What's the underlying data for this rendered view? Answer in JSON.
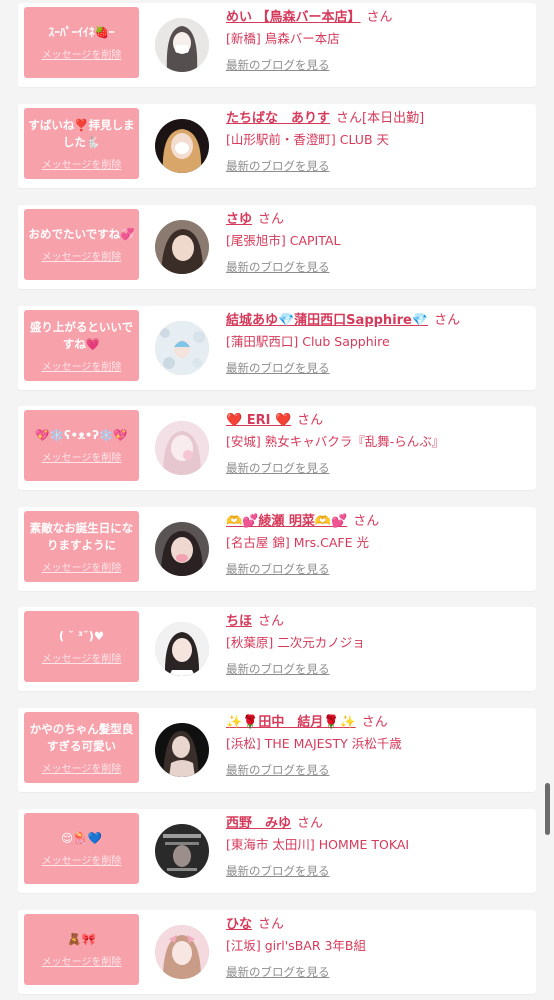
{
  "common": {
    "delete_label": "メッセージを削除",
    "blog_label": "最新のブログを見る"
  },
  "colors": {
    "stamp_bg": "#f7a1ab",
    "name": "#d63a5b",
    "link_gray": "#8d8d8d",
    "page_bg": "#f4f4f4"
  },
  "items": [
    {
      "stamp": "ｽｰﾊﾟｰｲｲﾈ🍓ｰ",
      "name": "めい 【鳥森バー本店】",
      "san": "さん",
      "shop": "[新橋] 鳥森バー本店"
    },
    {
      "stamp": "すばいね❣️拝見しました🐇",
      "name": "たちばな　ありす",
      "san": "さん[本日出勤]",
      "shop": "[山形駅前・香澄町] CLUB 天"
    },
    {
      "stamp": "おめでたいですね💞",
      "name": "さゆ",
      "san": "さん",
      "shop": "[尾張旭市] CAPITAL"
    },
    {
      "stamp": "盛り上がるといいですね💗",
      "name": "結城あゆ💎蒲田西口Sapphire💎",
      "san": "さん",
      "shop": "[蒲田駅西口] Club Sapphire"
    },
    {
      "stamp": "💖❄️ʕ•ᴥ•ʔ❄️💖",
      "name": "❤️ ERI ❤️",
      "san": "さん",
      "shop": "[安城] 熟女キャバクラ『乱舞-らんぶ』"
    },
    {
      "stamp": "素敵なお誕生日になりますように",
      "name": "🫶💕綾瀬 明菜🫶💕",
      "san": "さん",
      "shop": "[名古屋 錦] Mrs.CAFE 光"
    },
    {
      "stamp": "( ˘ ³˘)♥",
      "name": "ちほ",
      "san": "さん",
      "shop": "[秋葉原] 二次元カノジョ"
    },
    {
      "stamp": "かやのちゃん髪型良すぎる可愛い",
      "name": "✨🌹田中　結月🌹✨",
      "san": "さん",
      "shop": "[浜松] THE MAJESTY 浜松千歳"
    },
    {
      "stamp": "😌🪼💙",
      "name": "西野　みゆ",
      "san": "さん",
      "shop": "[東海市 太田川] HOMME TOKAI"
    },
    {
      "stamp": "🧸🎀",
      "name": "ひな",
      "san": "さん",
      "shop": "[江坂] girl'sBAR 3年B組"
    }
  ]
}
